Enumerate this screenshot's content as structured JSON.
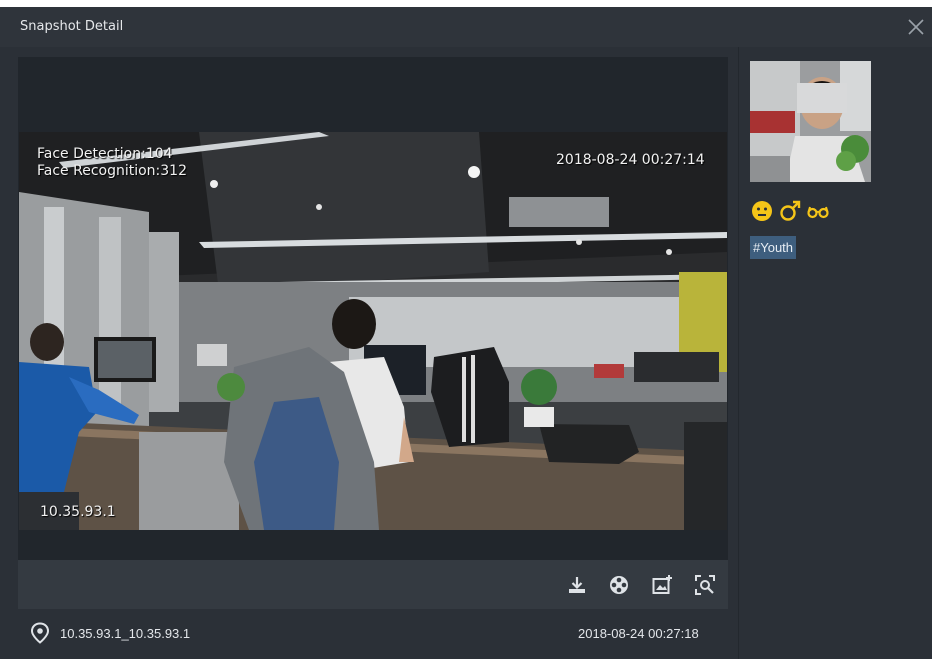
{
  "dialog": {
    "title": "Snapshot Detail",
    "close_icon": "close-icon"
  },
  "video": {
    "osd_line1": "Face Detection:104",
    "osd_line2": "Face Recognition:312",
    "osd_timestamp": "2018-08-24 00:27:14",
    "osd_camera": "10.35.93.1"
  },
  "toolbar": {
    "icons": [
      "download-icon",
      "video-reel-icon",
      "add-to-library-icon",
      "face-search-icon"
    ]
  },
  "footer": {
    "location_icon": "location-pin-icon",
    "location": "10.35.93.1_10.35.93.1",
    "time": "2018-08-24 00:27:18"
  },
  "attributes": {
    "icons": [
      "neutral-face-icon",
      "male-icon",
      "glasses-icon"
    ],
    "tag": "#Youth"
  },
  "colors": {
    "background": "#2b3037",
    "viewer": "#21262c",
    "accent_yellow": "#f5c518",
    "tag_bg": "#3e5e7e"
  }
}
